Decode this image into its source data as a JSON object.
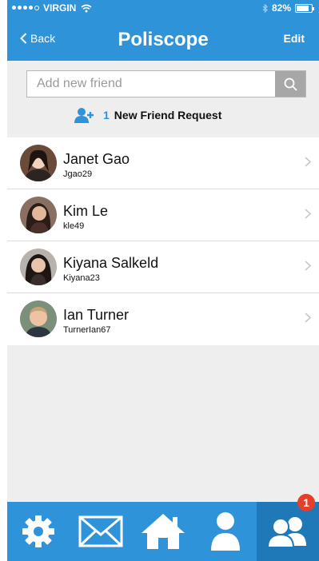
{
  "status": {
    "carrier": "VIRGIN",
    "battery": "82%"
  },
  "nav": {
    "back_label": "Back",
    "title": "Poliscope",
    "edit_label": "Edit"
  },
  "search": {
    "placeholder": "Add new friend",
    "value": ""
  },
  "friend_request": {
    "count": "1",
    "label": "New Friend Request"
  },
  "friends": [
    {
      "name": "Janet Gao",
      "username": "Jgao29",
      "avatar_color": "#6b4a3a"
    },
    {
      "name": "Kim Le",
      "username": "kle49",
      "avatar_color": "#3b2a22"
    },
    {
      "name": "Kiyana Salkeld",
      "username": "Kiyana23",
      "avatar_color": "#3a2e2a"
    },
    {
      "name": "Ian Turner",
      "username": "TurnerIan67",
      "avatar_color": "#c9a27a"
    }
  ],
  "tabbar": {
    "tabs": [
      {
        "icon": "gear-icon"
      },
      {
        "icon": "mail-icon"
      },
      {
        "icon": "home-icon"
      },
      {
        "icon": "profile-icon"
      },
      {
        "icon": "friends-icon",
        "active": true,
        "badge": "1"
      }
    ]
  },
  "colors": {
    "brand": "#2f93d9",
    "active_tab": "#1f78b8",
    "badge": "#e53e2b"
  }
}
